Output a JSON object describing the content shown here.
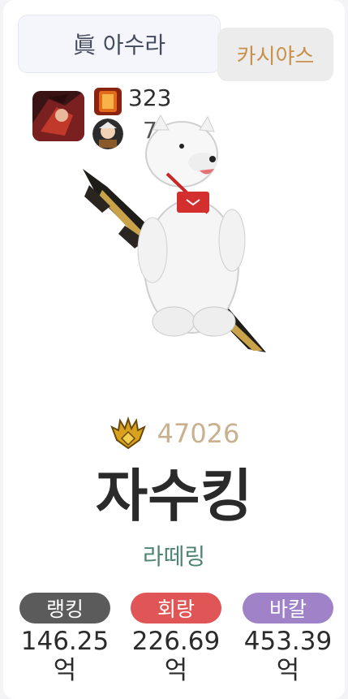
{
  "tabs": {
    "server_label": "眞 아수라",
    "job_label": "카시야스"
  },
  "level": {
    "value": "323",
    "secondary_value": "7"
  },
  "fame": {
    "value": "47026"
  },
  "character": {
    "name": "자수킹",
    "guild": "라떼링"
  },
  "stats": [
    {
      "label": "랭킹",
      "value": "146.25",
      "unit": "억",
      "color": "#5b5b5b"
    },
    {
      "label": "회랑",
      "value": "226.69",
      "unit": "억",
      "color": "#e05555"
    },
    {
      "label": "바칼",
      "value": "453.39",
      "unit": "억",
      "color": "#9f82c8"
    }
  ],
  "icons": {
    "avatar": "character-portrait-icon",
    "level": "adventure-level-icon",
    "sub": "buff-character-icon",
    "fame": "fame-laurel-icon"
  },
  "colors": {
    "fame_text": "#c9b08e",
    "guild_text": "#4e8474",
    "job_text": "#c9904a"
  }
}
